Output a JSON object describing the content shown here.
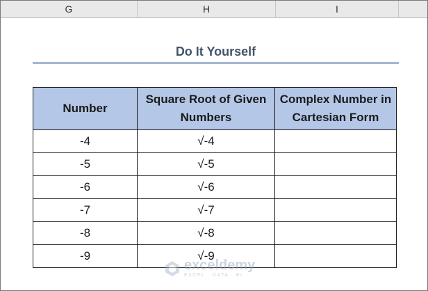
{
  "columns": [
    "G",
    "H",
    "I"
  ],
  "title": "Do It Yourself",
  "table": {
    "headers": [
      "Number",
      "Square Root of Given Numbers",
      "Complex Number in Cartesian Form"
    ],
    "rows": [
      [
        "-4",
        "√-4",
        ""
      ],
      [
        "-5",
        "√-5",
        ""
      ],
      [
        "-6",
        "√-6",
        ""
      ],
      [
        "-7",
        "√-7",
        ""
      ],
      [
        "-8",
        "√-8",
        ""
      ],
      [
        "-9",
        "√-9",
        ""
      ]
    ]
  },
  "watermark": {
    "name": "exceldemy",
    "tagline": "EXCEL · DATA · BI"
  },
  "colors": {
    "header_fill": "#b4c7e7",
    "title_color": "#44546a",
    "rule_color": "#a4b7d3"
  }
}
